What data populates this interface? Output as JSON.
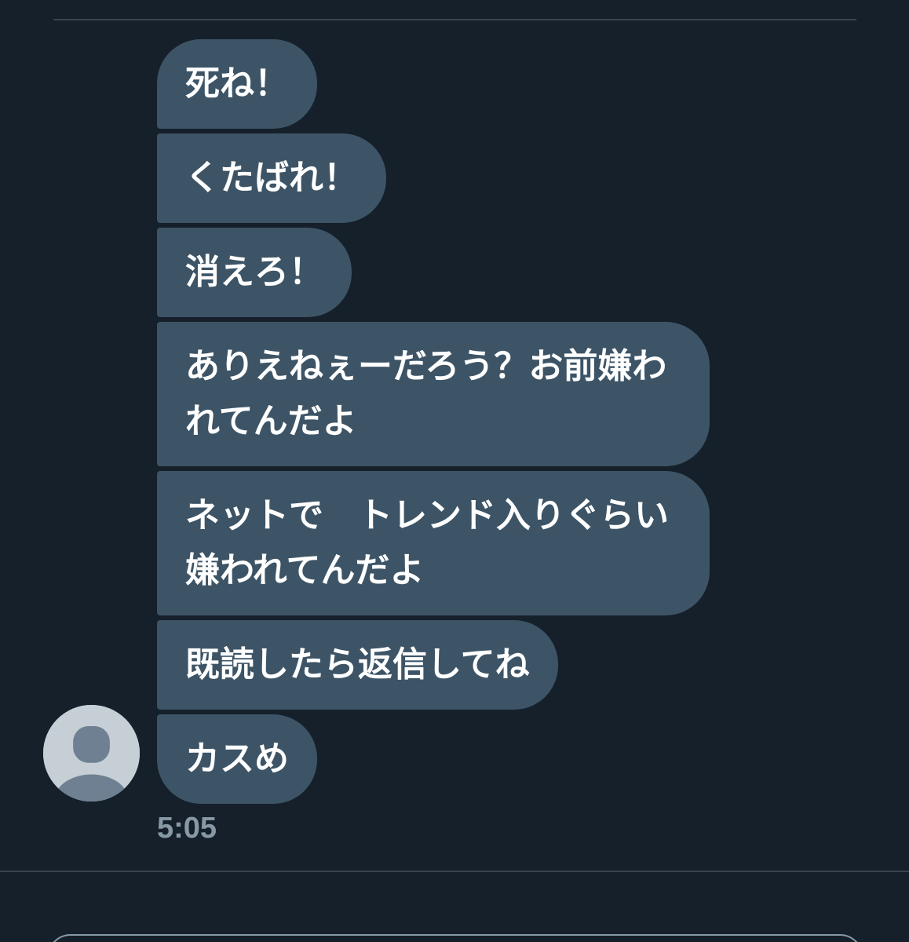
{
  "messages": [
    {
      "text": "死ね！"
    },
    {
      "text": "くたばれ！"
    },
    {
      "text": "消えろ！"
    },
    {
      "text": "ありえねぇーだろう？お前嫌われてんだよ"
    },
    {
      "text": "ネットで　トレンド入りぐらい嫌われてんだよ"
    },
    {
      "text": "既読したら返信してね"
    },
    {
      "text": "カスめ"
    }
  ],
  "timestamp": "5:05",
  "colors": {
    "background": "#15202b",
    "bubble": "#3d5466",
    "divider": "#38444d",
    "timestamp": "#8899a6",
    "avatar_bg": "#c6cfd6",
    "avatar_fg": "#6e8092"
  },
  "sender": {
    "avatar_icon": "default-user-avatar-icon"
  }
}
